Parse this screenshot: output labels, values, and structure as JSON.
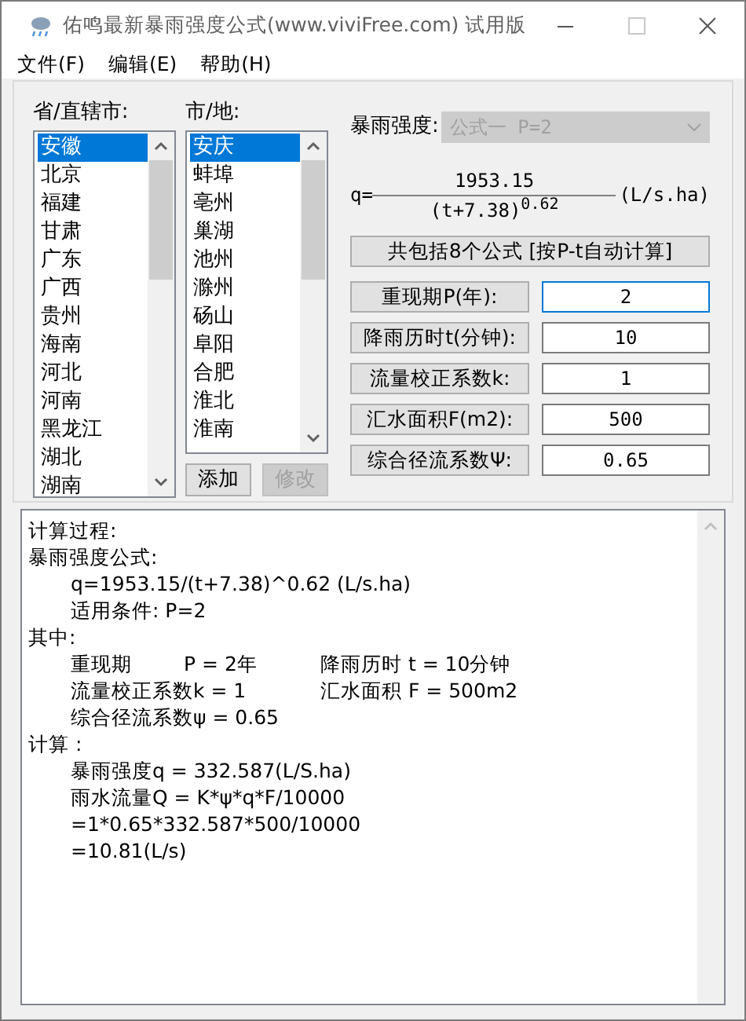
{
  "window": {
    "title": "佑鸣最新暴雨强度公式(www.viviFree.com) 试用版",
    "maximize_disabled": true
  },
  "menu": [
    "文件(F)",
    "编辑(E)",
    "帮助(H)"
  ],
  "province_list": {
    "label": "省/直辖市:",
    "items": [
      {
        "text": "安徽",
        "selected": true
      },
      {
        "text": "北京",
        "selected": false
      },
      {
        "text": "福建",
        "selected": false
      },
      {
        "text": "甘肃",
        "selected": false
      },
      {
        "text": "广东",
        "selected": false
      },
      {
        "text": "广西",
        "selected": false
      },
      {
        "text": "贵州",
        "selected": false
      },
      {
        "text": "海南",
        "selected": false
      },
      {
        "text": "河北",
        "selected": false
      },
      {
        "text": "河南",
        "selected": false
      },
      {
        "text": "黑龙江",
        "selected": false
      },
      {
        "text": "湖北",
        "selected": false
      },
      {
        "text": "湖南",
        "selected": false
      }
    ]
  },
  "city_list": {
    "label": "市/地:",
    "items": [
      {
        "text": "安庆",
        "selected": true
      },
      {
        "text": "蚌埠",
        "selected": false
      },
      {
        "text": "亳州",
        "selected": false
      },
      {
        "text": "巢湖",
        "selected": false
      },
      {
        "text": "池州",
        "selected": false
      },
      {
        "text": "滁州",
        "selected": false
      },
      {
        "text": "砀山",
        "selected": false
      },
      {
        "text": "阜阳",
        "selected": false
      },
      {
        "text": "合肥",
        "selected": false
      },
      {
        "text": "淮北",
        "selected": false
      },
      {
        "text": "淮南",
        "selected": false
      }
    ]
  },
  "list_buttons": [
    {
      "label": "添加",
      "disabled": false
    },
    {
      "label": "修改",
      "disabled": true
    }
  ],
  "formula_select": {
    "label": "暴雨强度:",
    "value": "公式一 P=2",
    "disabled": true
  },
  "formula": {
    "prefix": "q=",
    "numerator": "1953.15",
    "denominator": "(t+7.38)",
    "exponent": "0.62",
    "unit": "(L/s.ha)"
  },
  "formula_count_button": "共包括8个公式 [按P-t自动计算]",
  "params": [
    {
      "label": "重现期P(年):",
      "value": "2",
      "focused": true
    },
    {
      "label": "降雨历时t(分钟):",
      "value": "10",
      "focused": false
    },
    {
      "label": "流量校正系数k:",
      "value": "1",
      "focused": false
    },
    {
      "label": "汇水面积F(m2):",
      "value": "500",
      "focused": false
    },
    {
      "label": "综合径流系数Ψ:",
      "value": "0.65",
      "focused": false
    }
  ],
  "output": [
    {
      "text": "计算过程:"
    },
    {
      "text": "暴雨强度公式:",
      "children": [
        {
          "text": "q=1953.15/(t+7.38)^0.62 (L/s.ha)"
        },
        {
          "text": "适用条件: P=2"
        }
      ]
    },
    {
      "text": "其中:",
      "children": [
        {
          "cells": [
            "重现期",
            "P = 2年",
            "降雨历时 t = 10分钟"
          ]
        },
        {
          "cells": [
            "流量校正系数k = 1",
            "汇水面积 F = 500m2"
          ]
        },
        {
          "text": "综合径流系数ψ = 0.65"
        }
      ]
    },
    {
      "text": "计算 :",
      "children": [
        {
          "text": "暴雨强度q = 332.587(L/S.ha)"
        },
        {
          "text": "雨水流量Q = K*ψ*q*F/10000"
        },
        {
          "text": "=1*0.65*332.587*500/10000"
        },
        {
          "text": "=10.81(L/s)"
        }
      ]
    }
  ]
}
